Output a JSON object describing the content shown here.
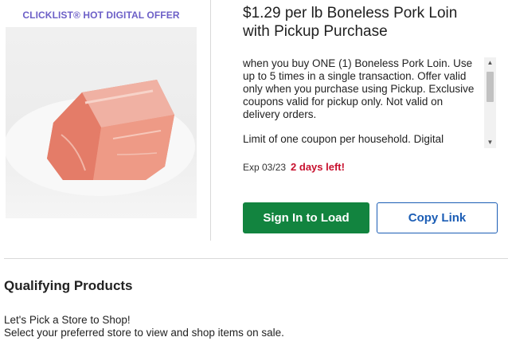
{
  "offer": {
    "tag": "CLICKLIST® HOT DIGITAL OFFER",
    "image_alt": "Boneless Pork Loin",
    "title": "$1.29 per lb Boneless Pork Loin with Pickup Purchase",
    "description": [
      "when you buy ONE (1) Boneless Pork Loin. Use up to 5 times in a single transaction. Offer valid only when you purchase using Pickup. Exclusive coupons valid for pickup only. Not valid on delivery orders.",
      "Limit of one coupon per household. Digital"
    ],
    "expiry_label": "Exp 03/23",
    "days_left": "2 days left!",
    "signin_button": "Sign In to Load",
    "copy_button": "Copy Link"
  },
  "qualifying": {
    "title": "Qualifying Products",
    "store_prompt": "Let's Pick a Store to Shop!",
    "store_subtext": "Select your preferred store to view and shop items on sale."
  },
  "colors": {
    "tag": "#6c5fc7",
    "primary_button": "#12843f",
    "link": "#1b5db5",
    "urgent": "#c8102e"
  },
  "icons": {
    "scroll_up": "scroll-up-arrow-icon",
    "scroll_down": "scroll-down-arrow-icon"
  }
}
